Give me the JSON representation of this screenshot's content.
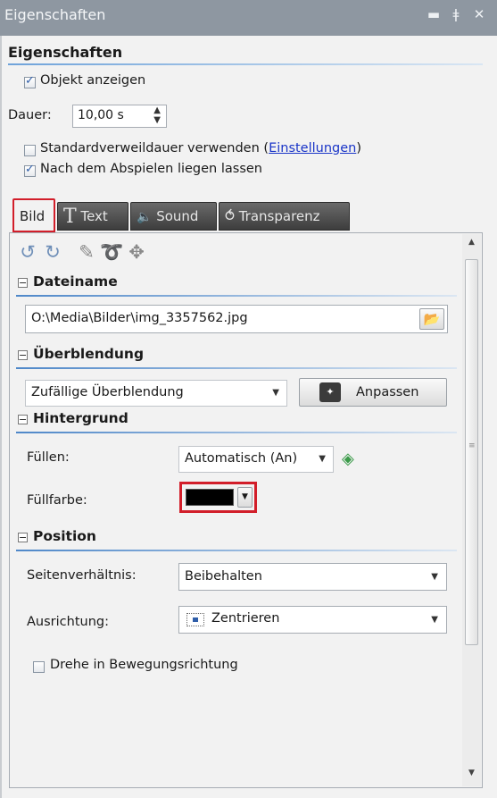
{
  "window": {
    "title": "Eigenschaften",
    "controls": {
      "minimize_glyph": "▬",
      "pin_glyph": "ǂ",
      "close_glyph": "✕"
    }
  },
  "header": {
    "title": "Eigenschaften"
  },
  "options": {
    "show_object": {
      "label": "Objekt anzeigen",
      "checked": true
    },
    "duration": {
      "label": "Dauer:",
      "value": "10,00 s"
    },
    "default_duration": {
      "label": "Standardverweildauer verwenden (",
      "link": "Einstellungen",
      "suffix": ")",
      "checked": false
    },
    "stay_after_play": {
      "label": "Nach dem Abspielen liegen lassen",
      "checked": true
    }
  },
  "tabs": [
    {
      "label": "Bild",
      "icon": "",
      "active": true
    },
    {
      "label": "Text",
      "icon": "text-icon",
      "glyph": "T",
      "active": false
    },
    {
      "label": "Sound",
      "icon": "speaker-icon",
      "glyph": "🔈",
      "active": false
    },
    {
      "label": "Transparenz",
      "icon": "transparency-icon",
      "glyph": "⥀",
      "active": false
    }
  ],
  "toolbar": {
    "rotate_left_glyph": "↺",
    "rotate_right_glyph": "↻",
    "draw_glyph": "✎",
    "path_glyph": "➰",
    "move_glyph": "✥"
  },
  "sections": {
    "filename": {
      "title": "Dateiname",
      "path": "O:\\Media\\Bilder\\img_3357562.jpg",
      "browse_glyph": "📂"
    },
    "transition": {
      "title": "Überblendung",
      "selected": "Zufällige Überblendung",
      "button": "Anpassen"
    },
    "background": {
      "title": "Hintergrund",
      "fill_label": "Füllen:",
      "fill_value": "Automatisch (An)",
      "color_label": "Füllfarbe:",
      "color_value": "#000000"
    },
    "position": {
      "title": "Position",
      "aspect_label": "Seitenverhältnis:",
      "aspect_value": "Beibehalten",
      "align_label": "Ausrichtung:",
      "align_value": "Zentrieren",
      "rotate_label": "Drehe in Bewegungsrichtung",
      "rotate_checked": false
    }
  },
  "highlight_color": "#d21e2a",
  "accent_color": "#4f88c9"
}
